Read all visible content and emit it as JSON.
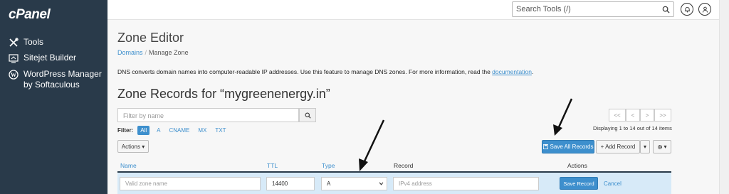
{
  "brand": {
    "logo": "cPanel"
  },
  "sidebar": {
    "items": [
      {
        "label": "Tools",
        "icon": "tools-icon"
      },
      {
        "label": "Sitejet Builder",
        "icon": "sitejet-icon"
      },
      {
        "label_line1": "WordPress Manager",
        "label_line2": "by Softaculous",
        "icon": "wordpress-icon"
      }
    ]
  },
  "header": {
    "search": {
      "placeholder": "Search Tools (/)"
    },
    "icons": [
      "search-icon",
      "bell-icon",
      "user-icon"
    ]
  },
  "page": {
    "title": "Zone Editor",
    "breadcrumb": {
      "home": "Domains",
      "separator": "/",
      "current": "Manage Zone"
    },
    "description": "DNS converts domain names into computer-readable IP addresses. Use this feature to manage DNS zones. For more information, read the",
    "doc_link": "documentation",
    "doc_suffix": "."
  },
  "zone": {
    "title": "Zone Records for “mygreenenergy.in”",
    "filter": {
      "placeholder": "Filter by name",
      "label": "Filter:",
      "chips": [
        "All",
        "A",
        "CNAME",
        "MX",
        "TXT"
      ],
      "active": "All"
    },
    "pagination": {
      "first": "<<",
      "prev": "<",
      "next": ">",
      "last": ">>",
      "status": "Displaying 1 to 14 out of 14 items"
    },
    "toolbar": {
      "actions_label": "Actions ▾",
      "save_all_label": "Save All Records",
      "add_record_label": "+ Add Record",
      "add_record_caret": "▾",
      "settings_caret": "▾"
    },
    "table": {
      "columns": [
        "Name",
        "TTL",
        "Type",
        "Record",
        "Actions"
      ]
    },
    "edit_row": {
      "name_placeholder": "Valid zone name",
      "ttl_value": "14400",
      "type_value": "A",
      "record_placeholder": "IPv4 address",
      "save_label": "Save Record",
      "cancel_label": "Cancel"
    }
  },
  "colors": {
    "sidebar": "#293a4a",
    "accent": "#3d8fcd",
    "edit_row": "#d7eaf8"
  }
}
